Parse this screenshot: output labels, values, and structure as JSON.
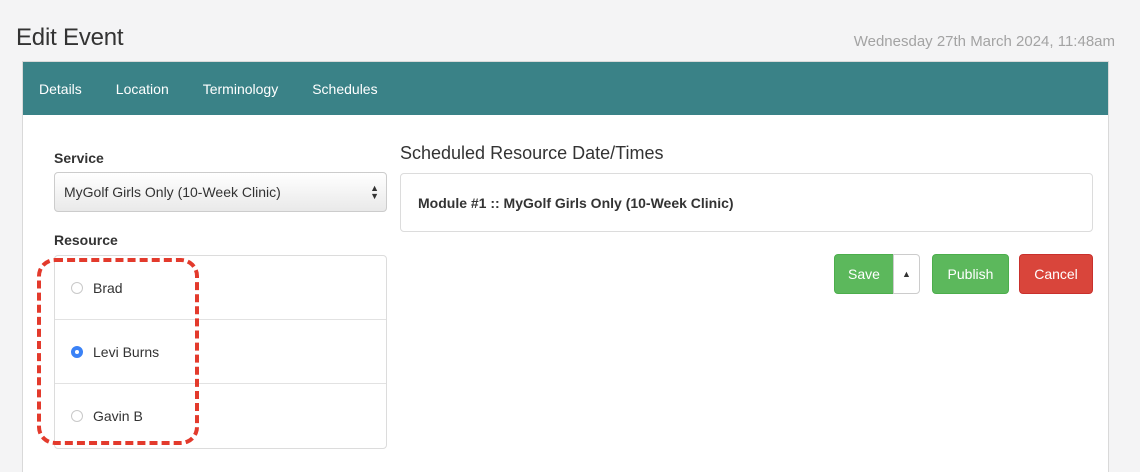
{
  "page": {
    "title": "Edit Event",
    "datetime": "Wednesday 27th March 2024, 11:48am"
  },
  "tabs": [
    "Details",
    "Location",
    "Terminology",
    "Schedules"
  ],
  "service": {
    "label": "Service",
    "selected": "MyGolf Girls Only (10-Week Clinic)"
  },
  "resource": {
    "label": "Resource",
    "options": [
      {
        "name": "Brad",
        "checked": false
      },
      {
        "name": "Levi Burns",
        "checked": true
      },
      {
        "name": "Gavin B",
        "checked": false
      }
    ]
  },
  "schedule": {
    "title": "Scheduled Resource Date/Times",
    "module": "Module #1 :: MyGolf Girls Only (10-Week Clinic)"
  },
  "actions": {
    "save": "Save",
    "publish": "Publish",
    "cancel": "Cancel"
  },
  "colors": {
    "tabbar": "#3a8287",
    "save": "#5cb85c",
    "cancel": "#d9453b",
    "highlight": "#e33a2c"
  }
}
